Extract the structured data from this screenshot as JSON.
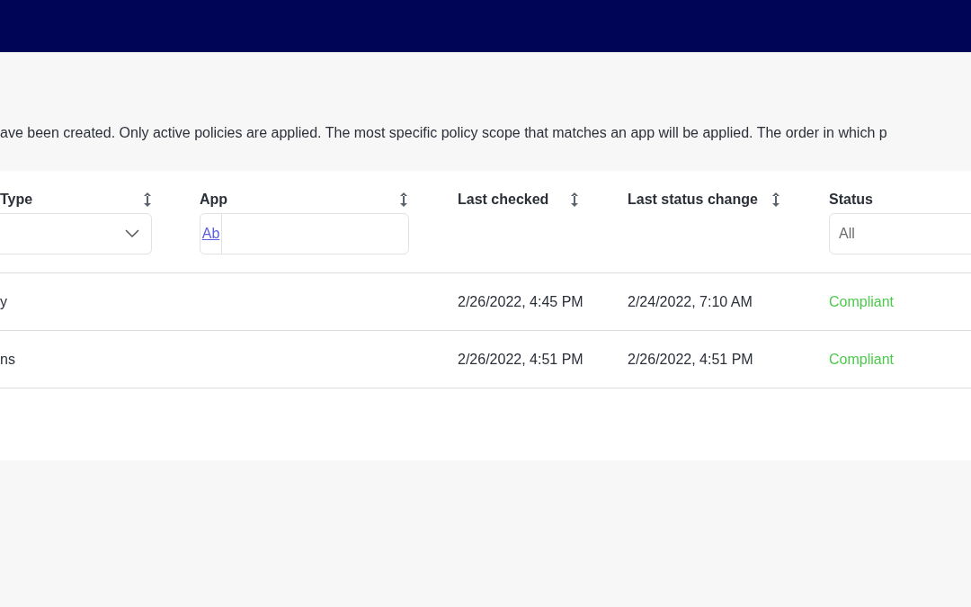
{
  "description": "ave been created. Only active policies are applied. The most specific policy scope that matches an app will be applied. The order in which p",
  "table": {
    "columns": [
      {
        "label": "Type",
        "sortable": true,
        "filter": {
          "kind": "dropdown"
        }
      },
      {
        "label": "App",
        "sortable": true,
        "filter": {
          "kind": "text",
          "match_label": "Ab"
        }
      },
      {
        "label": "Last checked",
        "sortable": true
      },
      {
        "label": "Last status change",
        "sortable": true
      },
      {
        "label": "Status",
        "sortable": false,
        "filter": {
          "kind": "select",
          "placeholder": "All"
        }
      }
    ],
    "rows": [
      {
        "cells": [
          "y",
          "",
          "2/26/2022, 4:45 PM",
          "2/24/2022, 7:10 AM",
          "Compliant"
        ]
      },
      {
        "cells": [
          "ns",
          "",
          "2/26/2022, 4:51 PM",
          "2/26/2022, 4:51 PM",
          "Compliant"
        ]
      }
    ]
  }
}
